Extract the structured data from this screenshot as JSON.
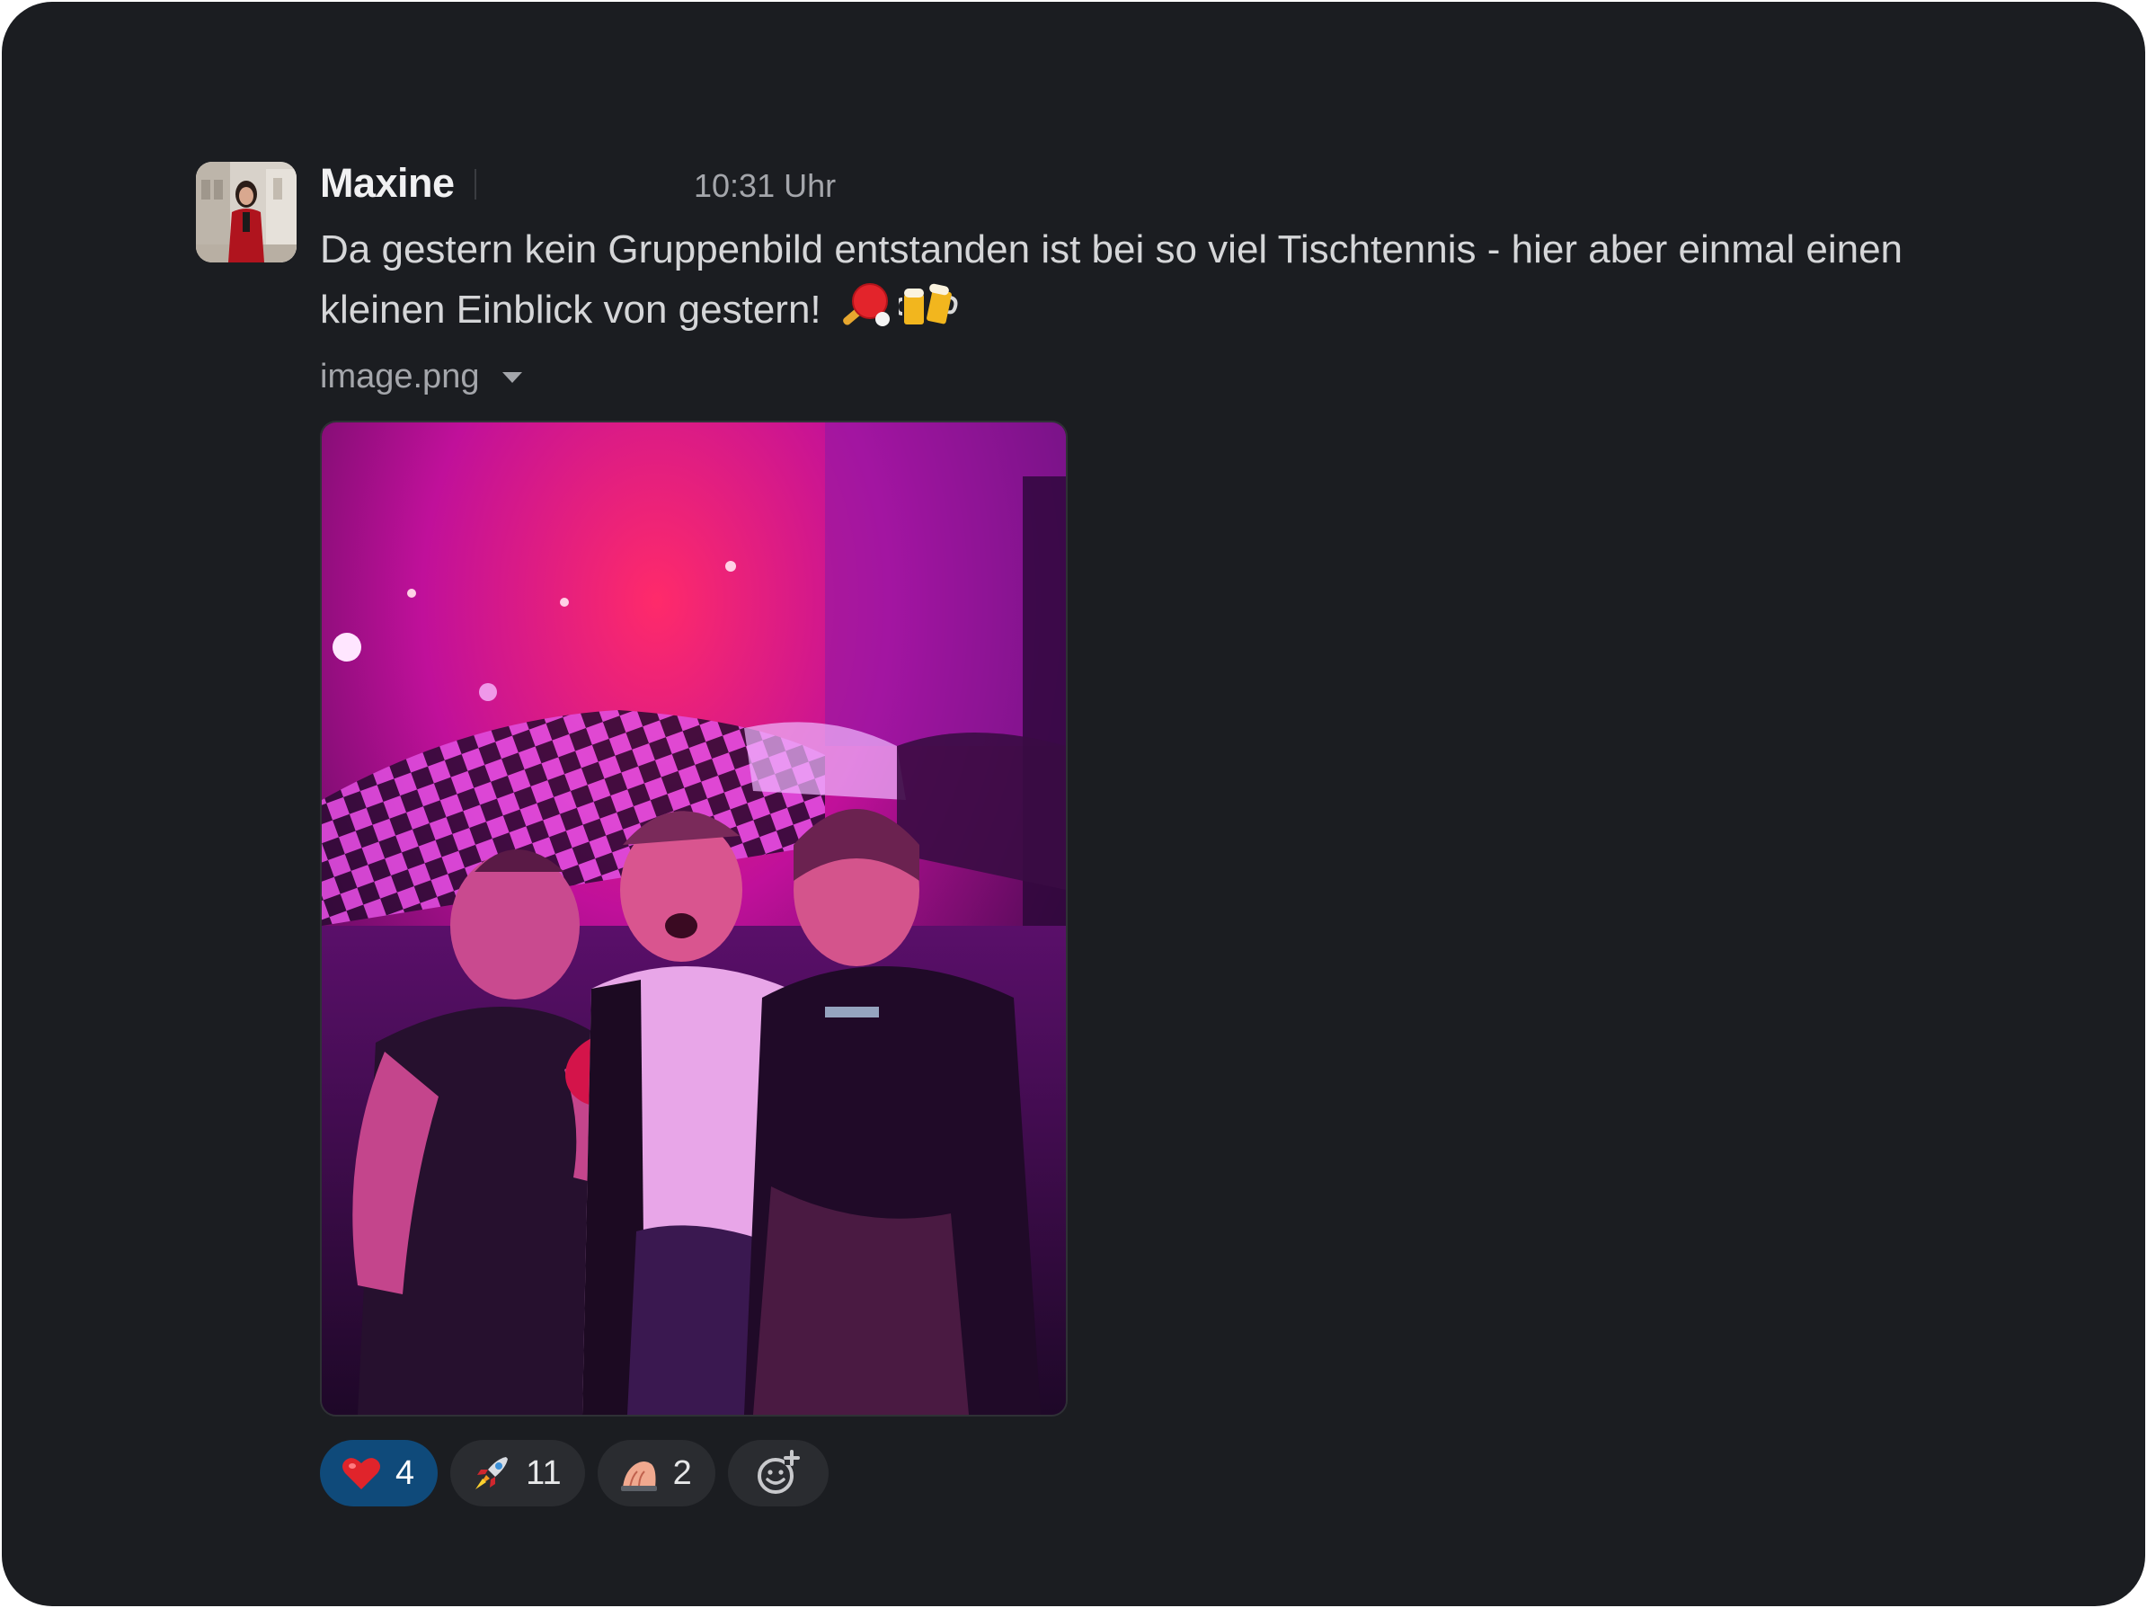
{
  "message": {
    "author": "Maxine",
    "timestamp": "10:31 Uhr",
    "text": "Da gestern kein Gruppenbild entstanden ist bei so viel Tischtennis - hier aber einmal einen kleinen Einblick von gestern!",
    "text_emojis": [
      "ping-pong",
      "beer-mugs"
    ]
  },
  "attachment": {
    "filename": "image.png",
    "alt": "Group photo of three friends in a pink-lit room"
  },
  "reactions": [
    {
      "emoji": "red-heart",
      "count": "4",
      "active": true
    },
    {
      "emoji": "rocket",
      "count": "11",
      "active": false
    },
    {
      "emoji": "hand-reaching",
      "count": "2",
      "active": false
    }
  ],
  "colors": {
    "background": "#1b1d21",
    "text": "#d5d6d8",
    "muted": "#a4a6ab",
    "reaction_active": "#0f4a7a",
    "reaction_bg": "#2a2c30"
  }
}
